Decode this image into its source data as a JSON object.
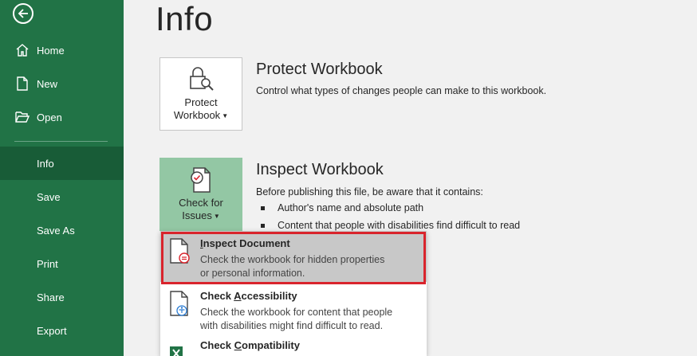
{
  "sidebar": {
    "items": [
      {
        "label": "Home"
      },
      {
        "label": "New"
      },
      {
        "label": "Open"
      },
      {
        "label": "Info"
      },
      {
        "label": "Save"
      },
      {
        "label": "Save As"
      },
      {
        "label": "Print"
      },
      {
        "label": "Share"
      },
      {
        "label": "Export"
      }
    ],
    "active": "Info",
    "bg_color": "#217346",
    "active_color": "#185c37"
  },
  "page": {
    "title": "Info"
  },
  "protect": {
    "button_line1": "Protect",
    "button_line2": "Workbook",
    "title": "Protect Workbook",
    "description": "Control what types of changes people can make to this workbook."
  },
  "inspect": {
    "button_line1": "Check for",
    "button_line2": "Issues",
    "title": "Inspect Workbook",
    "description": "Before publishing this file, be aware that it contains:",
    "bullets": [
      "Author's name and absolute path",
      "Content that people with disabilities find difficult to read"
    ]
  },
  "dropdown": {
    "items": [
      {
        "title_acc": "I",
        "title_rest": "nspect Document",
        "desc1": "Check the workbook for hidden properties",
        "desc2": "or personal information."
      },
      {
        "title_pre": "Check ",
        "title_acc": "A",
        "title_rest": "ccessibility",
        "desc1": "Check the workbook for content that people",
        "desc2": "with disabilities might find difficult to read."
      },
      {
        "title_pre": "Check ",
        "title_acc": "C",
        "title_rest": "ompatibility"
      }
    ]
  },
  "icons": {
    "back": "back-arrow-icon",
    "home": "home-icon",
    "new": "new-document-icon",
    "open": "open-folder-icon",
    "protect": "lock-magnifier-icon",
    "check": "document-check-icon"
  },
  "colors": {
    "highlight_border": "#d9242c",
    "check_button": "#93c7a4"
  }
}
